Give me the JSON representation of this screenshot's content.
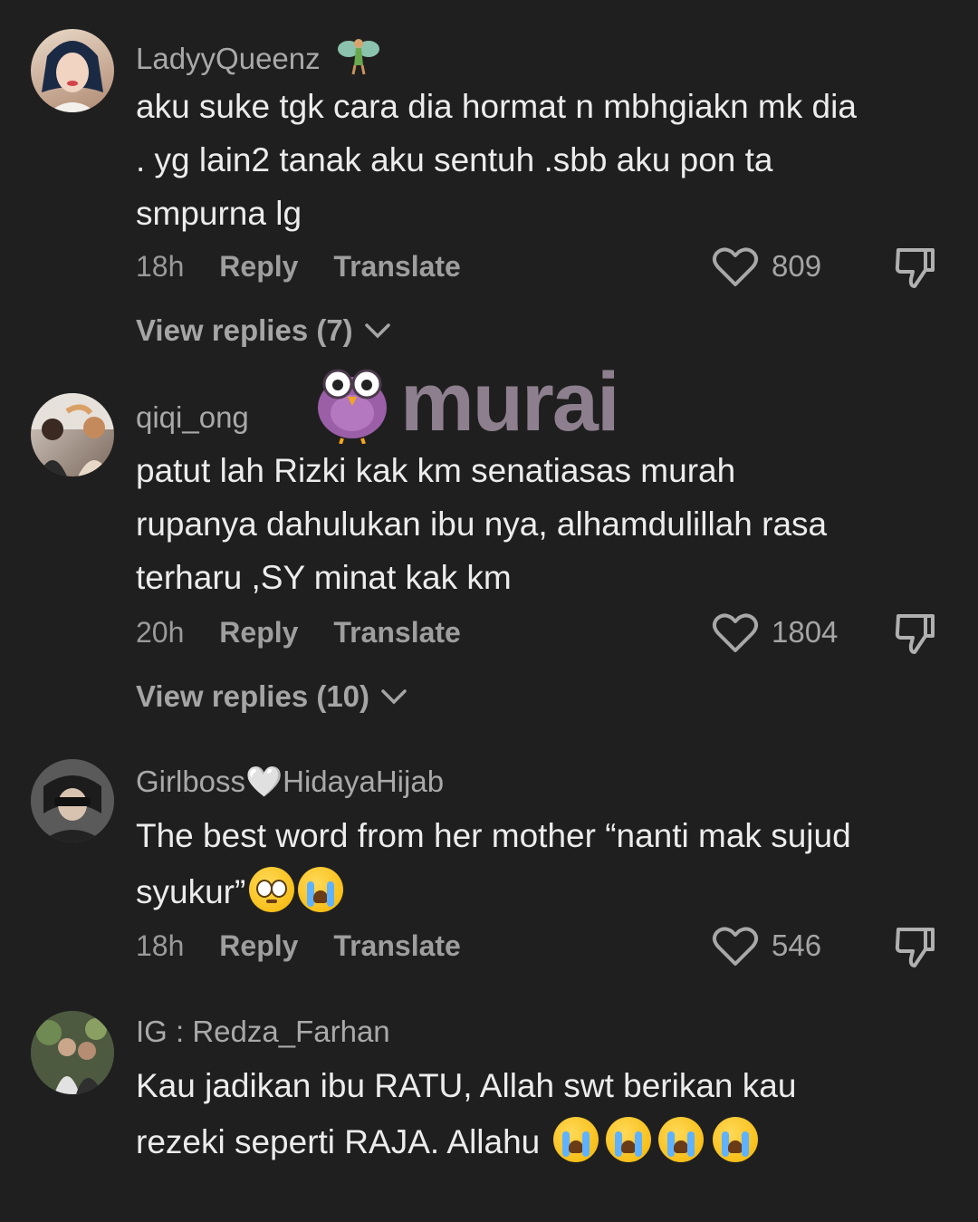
{
  "comments": [
    {
      "username": "LadyyQueenz",
      "username_badge": "fairy-icon",
      "text": "aku suke tgk cara dia hormat n mbhgiakn mk dia . yg lain2 tanak aku sentuh .sbb aku pon ta smpurna lg",
      "time": "18h",
      "reply_label": "Reply",
      "translate_label": "Translate",
      "likes": "809",
      "view_replies": "View replies (7)"
    },
    {
      "username": "qiqi_ong",
      "text": "patut lah Rizki kak km senatiasas murah rupanya dahulukan ibu nya, alhamdulillah rasa terharu ,SY minat kak km",
      "time": "20h",
      "reply_label": "Reply",
      "translate_label": "Translate",
      "likes": "1804",
      "view_replies": "View replies (10)"
    },
    {
      "username_a": "Girlboss",
      "username_heart": "🤍",
      "username_b": "HidayaHijab",
      "text": "The best word from her mother “nanti mak sujud syukur”",
      "text_emojis": [
        "pleading-face-emoji",
        "loudly-crying-face-emoji"
      ],
      "time": "18h",
      "reply_label": "Reply",
      "translate_label": "Translate",
      "likes": "546"
    },
    {
      "username": "IG : Redza_Farhan",
      "text": "Kau jadikan ibu RATU, Allah swt berikan kau rezeki seperti RAJA. Allahu",
      "text_emojis": [
        "loudly-crying-face-emoji",
        "loudly-crying-face-emoji",
        "loudly-crying-face-emoji",
        "loudly-crying-face-emoji"
      ]
    }
  ],
  "watermark": {
    "text": "murai"
  },
  "colors": {
    "background": "#1f1f1f",
    "text": "#ececec",
    "muted": "#9a9a9a",
    "watermark": "#8d7f8d"
  }
}
